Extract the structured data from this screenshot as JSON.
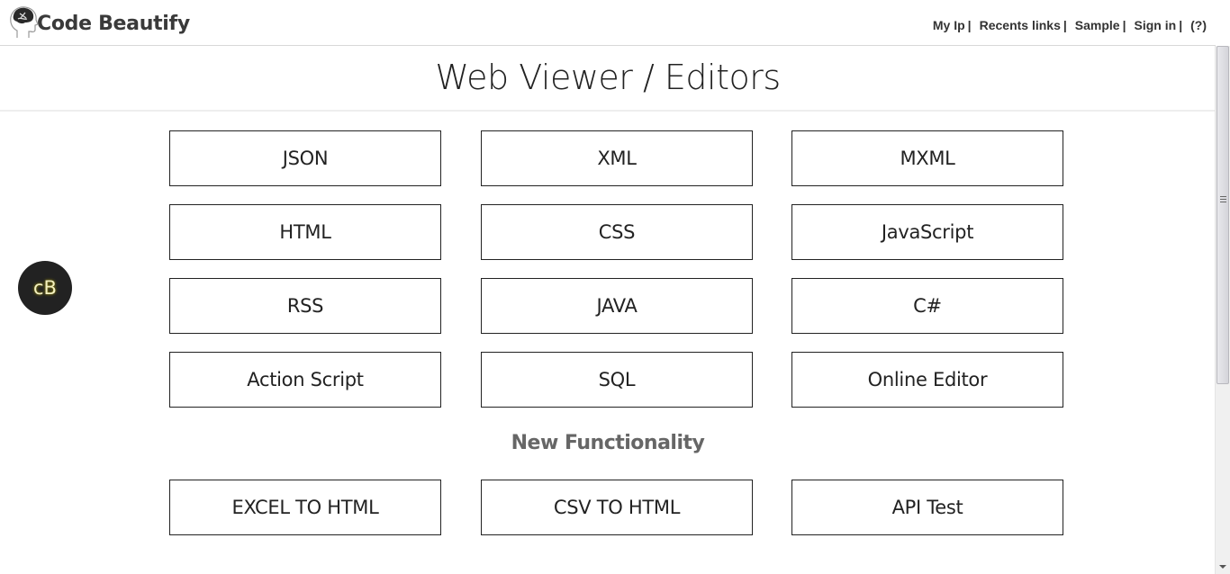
{
  "header": {
    "logo_text": "Code Beautify",
    "links": [
      {
        "label": "My Ip",
        "sep": "|"
      },
      {
        "label": "Recents links",
        "sep": "|"
      },
      {
        "label": "Sample",
        "sep": "|"
      },
      {
        "label": "Sign in",
        "sep": "|"
      },
      {
        "label": "(?)",
        "sep": ""
      }
    ]
  },
  "main": {
    "title": "Web Viewer / Editors",
    "tools": [
      {
        "label": "JSON"
      },
      {
        "label": "XML"
      },
      {
        "label": "MXML"
      },
      {
        "label": "HTML"
      },
      {
        "label": "CSS"
      },
      {
        "label": "JavaScript"
      },
      {
        "label": "RSS"
      },
      {
        "label": "JAVA"
      },
      {
        "label": "C#"
      },
      {
        "label": "Action Script"
      },
      {
        "label": "SQL"
      },
      {
        "label": "Online Editor"
      }
    ],
    "section_title": "New Functionality",
    "new_tools": [
      {
        "label": "EXCEL TO HTML"
      },
      {
        "label": "CSV TO HTML"
      },
      {
        "label": "API Test"
      }
    ]
  },
  "badge": {
    "label": "cB"
  }
}
